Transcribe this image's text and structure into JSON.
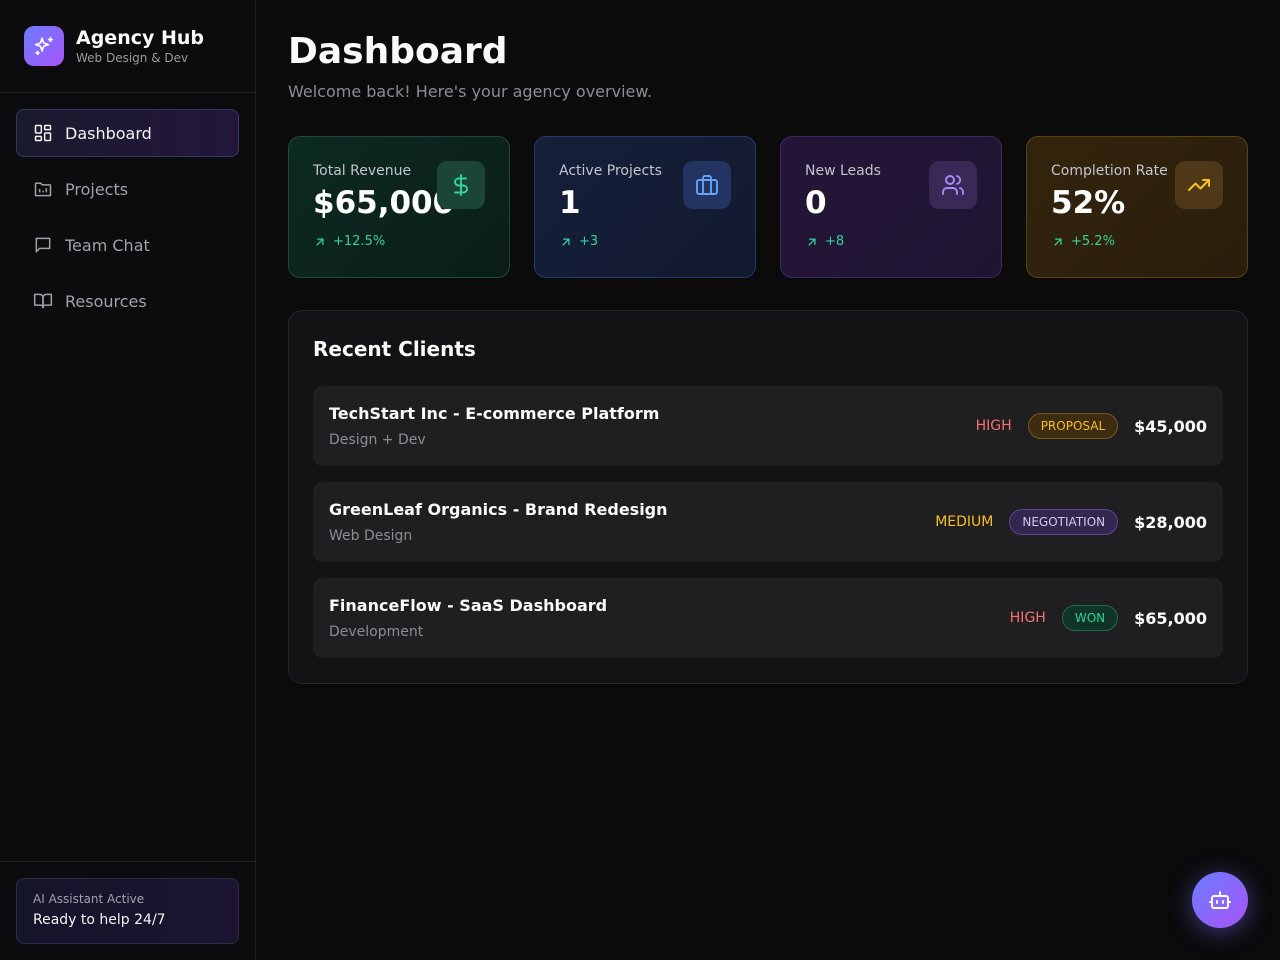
{
  "brand": {
    "title": "Agency Hub",
    "subtitle": "Web Design & Dev"
  },
  "nav": [
    {
      "label": "Dashboard",
      "icon": "dashboard-icon",
      "active": true
    },
    {
      "label": "Projects",
      "icon": "folder-icon",
      "active": false
    },
    {
      "label": "Team Chat",
      "icon": "chat-icon",
      "active": false
    },
    {
      "label": "Resources",
      "icon": "book-icon",
      "active": false
    }
  ],
  "assistant": {
    "status": "AI Assistant Active",
    "message": "Ready to help 24/7"
  },
  "header": {
    "title": "Dashboard",
    "subtitle": "Welcome back! Here's your agency overview."
  },
  "stats": [
    {
      "label": "Total Revenue",
      "value": "$65,000",
      "change": "+12.5%",
      "icon": "dollar-icon",
      "color": "#34d399"
    },
    {
      "label": "Active Projects",
      "value": "1",
      "change": "+3",
      "icon": "briefcase-icon",
      "color": "#60a5fa"
    },
    {
      "label": "New Leads",
      "value": "0",
      "change": "+8",
      "icon": "users-icon",
      "color": "#a78bfa"
    },
    {
      "label": "Completion Rate",
      "value": "52%",
      "change": "+5.2%",
      "icon": "trending-up-icon",
      "color": "#fbbf24"
    }
  ],
  "clients": {
    "title": "Recent Clients",
    "rows": [
      {
        "name": "TechStart Inc - E-commerce Platform",
        "type": "Design + Dev",
        "priority": "HIGH",
        "status": "PROPOSAL",
        "amount": "$45,000"
      },
      {
        "name": "GreenLeaf Organics - Brand Redesign",
        "type": "Web Design",
        "priority": "MEDIUM",
        "status": "NEGOTIATION",
        "amount": "$28,000"
      },
      {
        "name": "FinanceFlow - SaaS Dashboard",
        "type": "Development",
        "priority": "HIGH",
        "status": "WON",
        "amount": "$65,000"
      }
    ]
  },
  "fab": {
    "icon": "bot-icon"
  }
}
